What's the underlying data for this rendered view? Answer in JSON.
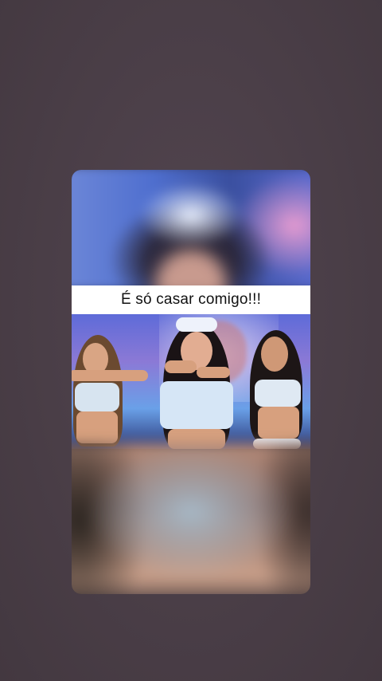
{
  "story": {
    "caption": "É só casar comigo!!!"
  },
  "colors": {
    "page_background": "#4b3f48",
    "caption_background": "#ffffff",
    "caption_text": "#111111"
  }
}
